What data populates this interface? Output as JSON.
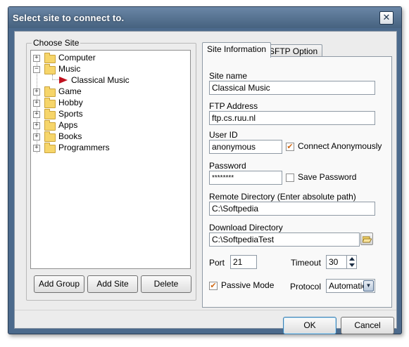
{
  "window": {
    "title": "Select site to connect to.",
    "close_glyph": "✕"
  },
  "choose_site": {
    "legend": "Choose Site",
    "tree": [
      {
        "label": "Computer",
        "expander": "+",
        "icon": "folder-icon"
      },
      {
        "label": "Music",
        "expander": "−",
        "icon": "folder-icon"
      },
      {
        "label": "Classical Music",
        "icon": "site-arrow-icon",
        "child_of": "Music"
      },
      {
        "label": "Game",
        "expander": "+",
        "icon": "folder-icon"
      },
      {
        "label": "Hobby",
        "expander": "+",
        "icon": "folder-icon"
      },
      {
        "label": "Sports",
        "expander": "+",
        "icon": "folder-icon"
      },
      {
        "label": "Apps",
        "expander": "+",
        "icon": "folder-icon"
      },
      {
        "label": "Books",
        "expander": "+",
        "icon": "folder-icon"
      },
      {
        "label": "Programmers",
        "expander": "+",
        "icon": "folder-icon"
      }
    ],
    "buttons": {
      "add_group": "Add Group",
      "add_site": "Add Site",
      "delete": "Delete"
    }
  },
  "tabs": {
    "site_information": "Site Information",
    "sftp_option": "SFTP Option"
  },
  "site_info": {
    "site_name_label": "Site name",
    "site_name_value": "Classical Music",
    "ftp_address_label": "FTP Address",
    "ftp_address_value": "ftp.cs.ruu.nl",
    "user_id_label": "User ID",
    "user_id_value": "anonymous",
    "connect_anon_label": "Connect Anonymously",
    "connect_anon_checked": true,
    "password_label": "Password",
    "password_value": "********",
    "save_password_label": "Save Password",
    "save_password_checked": false,
    "remote_dir_label": "Remote Directory (Enter absolute path)",
    "remote_dir_value": "C:\\Softpedia",
    "download_dir_label": "Download Directory",
    "download_dir_value": "C:\\SoftpediaTest",
    "port_label": "Port",
    "port_value": "21",
    "timeout_label": "Timeout",
    "timeout_value": "30",
    "passive_mode_label": "Passive Mode",
    "passive_mode_checked": true,
    "protocol_label": "Protocol",
    "protocol_value": "Automatic",
    "check_glyph": "✔"
  },
  "footer": {
    "ok": "OK",
    "cancel": "Cancel"
  },
  "colors": {
    "title_bar": "#4c6a8c",
    "checkmark": "#d06a17",
    "site_arrow": "#c0111f"
  }
}
